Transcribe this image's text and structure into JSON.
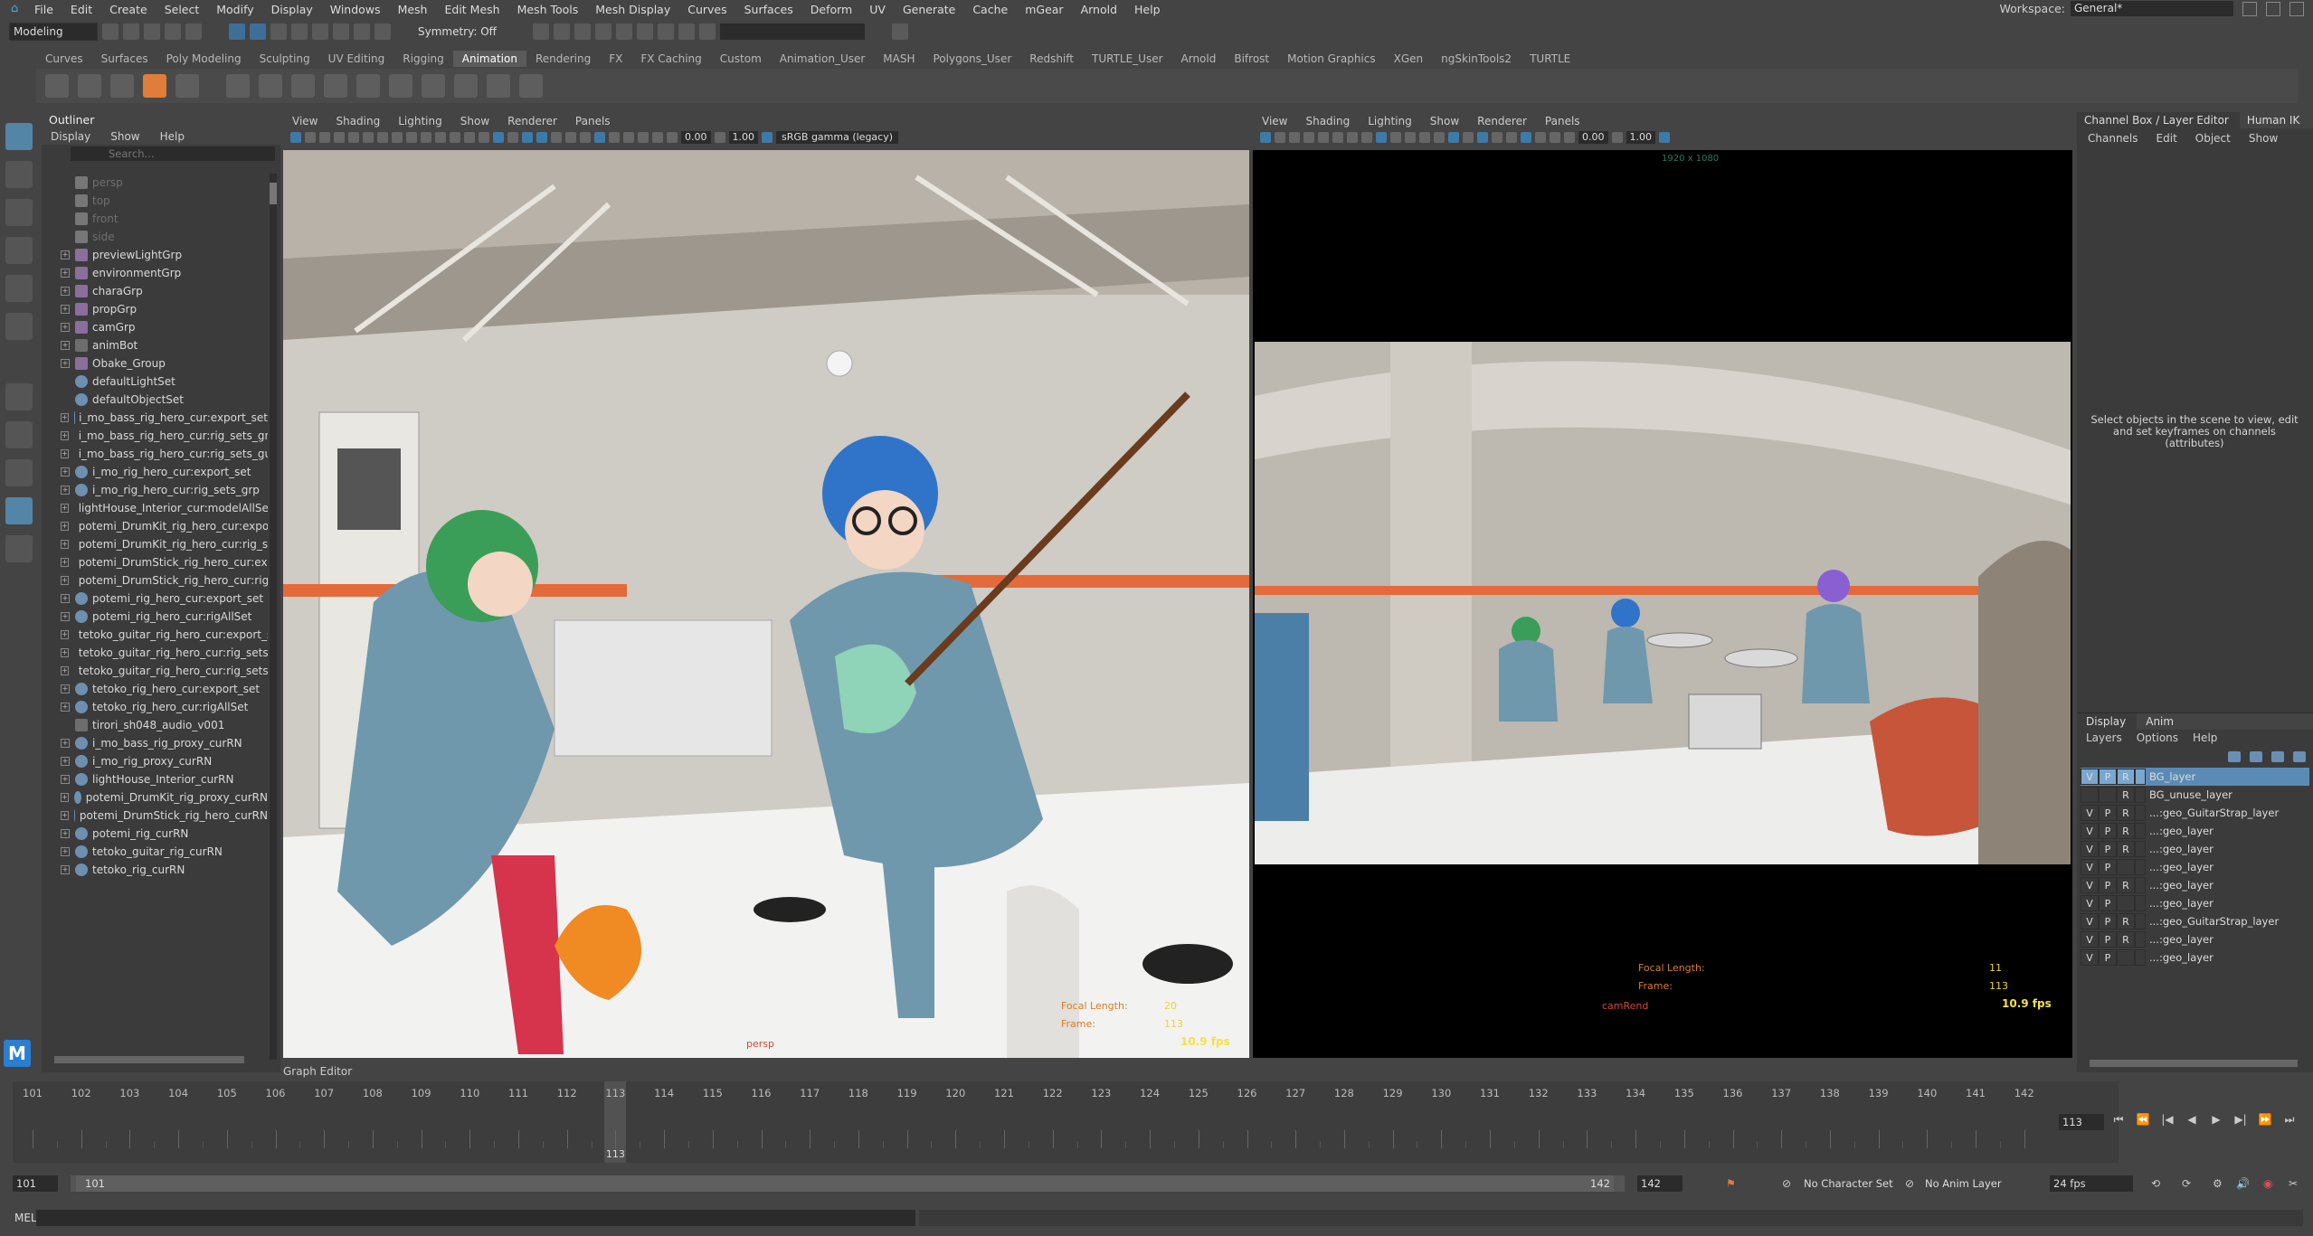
{
  "menubar": {
    "items": [
      "File",
      "Edit",
      "Create",
      "Select",
      "Modify",
      "Display",
      "Windows",
      "Mesh",
      "Edit Mesh",
      "Mesh Tools",
      "Mesh Display",
      "Curves",
      "Surfaces",
      "Deform",
      "UV",
      "Generate",
      "Cache",
      "mGear",
      "Arnold",
      "Help"
    ],
    "workspace_label": "Workspace:",
    "workspace_value": "General*"
  },
  "statusline": {
    "mode": "Modeling",
    "symmetry": "Symmetry: Off"
  },
  "shelf": {
    "tabs": [
      "Curves",
      "Surfaces",
      "Poly Modeling",
      "Sculpting",
      "UV Editing",
      "Rigging",
      "Animation",
      "Rendering",
      "FX",
      "FX Caching",
      "Custom",
      "Animation_User",
      "MASH",
      "Polygons_User",
      "Redshift",
      "TURTLE_User",
      "Arnold",
      "Bifrost",
      "Motion Graphics",
      "XGen",
      "ngSkinTools2",
      "TURTLE"
    ],
    "active": "Animation"
  },
  "outliner": {
    "title": "Outliner",
    "menu": [
      "Display",
      "Show",
      "Help"
    ],
    "search_placeholder": "Search...",
    "items": [
      {
        "label": "persp",
        "icon": "camera-icon",
        "dim": true,
        "exp": false
      },
      {
        "label": "top",
        "icon": "camera-icon",
        "dim": true,
        "exp": false
      },
      {
        "label": "front",
        "icon": "camera-icon",
        "dim": true,
        "exp": false
      },
      {
        "label": "side",
        "icon": "camera-icon",
        "dim": true,
        "exp": false
      },
      {
        "label": "previewLightGrp",
        "icon": "group-icon",
        "exp": true
      },
      {
        "label": "environmentGrp",
        "icon": "group-icon",
        "exp": true
      },
      {
        "label": "charaGrp",
        "icon": "group-icon",
        "exp": true
      },
      {
        "label": "propGrp",
        "icon": "group-icon",
        "exp": true
      },
      {
        "label": "camGrp",
        "icon": "group-icon",
        "exp": true
      },
      {
        "label": "animBot",
        "icon": "node-icon",
        "exp": true
      },
      {
        "label": "Obake_Group",
        "icon": "group-icon",
        "exp": true
      },
      {
        "label": "defaultLightSet",
        "icon": "set-icon",
        "exp": false
      },
      {
        "label": "defaultObjectSet",
        "icon": "set-icon",
        "exp": false
      },
      {
        "label": "i_mo_bass_rig_hero_cur:export_set",
        "icon": "set-icon",
        "exp": true
      },
      {
        "label": "i_mo_bass_rig_hero_cur:rig_sets_grp",
        "icon": "set-icon",
        "exp": true
      },
      {
        "label": "i_mo_bass_rig_hero_cur:rig_sets_guit",
        "icon": "set-icon",
        "exp": true
      },
      {
        "label": "i_mo_rig_hero_cur:export_set",
        "icon": "set-icon",
        "exp": true
      },
      {
        "label": "i_mo_rig_hero_cur:rig_sets_grp",
        "icon": "set-icon",
        "exp": true
      },
      {
        "label": "lightHouse_Interior_cur:modelAllSet",
        "icon": "set-icon",
        "exp": true
      },
      {
        "label": "potemi_DrumKit_rig_hero_cur:export_",
        "icon": "set-icon",
        "exp": true
      },
      {
        "label": "potemi_DrumKit_rig_hero_cur:rig_set:",
        "icon": "set-icon",
        "exp": true
      },
      {
        "label": "potemi_DrumStick_rig_hero_cur:expo",
        "icon": "set-icon",
        "exp": true
      },
      {
        "label": "potemi_DrumStick_rig_hero_cur:rig_s",
        "icon": "set-icon",
        "exp": true
      },
      {
        "label": "potemi_rig_hero_cur:export_set",
        "icon": "set-icon",
        "exp": true
      },
      {
        "label": "potemi_rig_hero_cur:rigAllSet",
        "icon": "set-icon",
        "exp": true
      },
      {
        "label": "tetoko_guitar_rig_hero_cur:export_se",
        "icon": "set-icon",
        "exp": true
      },
      {
        "label": "tetoko_guitar_rig_hero_cur:rig_sets_(",
        "icon": "set-icon",
        "exp": true
      },
      {
        "label": "tetoko_guitar_rig_hero_cur:rig_sets_(",
        "icon": "set-icon",
        "exp": true
      },
      {
        "label": "tetoko_rig_hero_cur:export_set",
        "icon": "set-icon",
        "exp": true
      },
      {
        "label": "tetoko_rig_hero_cur:rigAllSet",
        "icon": "set-icon",
        "exp": true
      },
      {
        "label": "tirori_sh048_audio_v001",
        "icon": "audio-icon",
        "exp": false
      },
      {
        "label": "i_mo_bass_rig_proxy_curRN",
        "icon": "reference-icon",
        "exp": true
      },
      {
        "label": "i_mo_rig_proxy_curRN",
        "icon": "reference-icon",
        "exp": true
      },
      {
        "label": "lightHouse_Interior_curRN",
        "icon": "reference-icon",
        "exp": true
      },
      {
        "label": "potemi_DrumKit_rig_proxy_curRN",
        "icon": "reference-icon",
        "exp": true
      },
      {
        "label": "potemi_DrumStick_rig_hero_curRN",
        "icon": "reference-icon",
        "exp": true
      },
      {
        "label": "potemi_rig_curRN",
        "icon": "reference-icon",
        "exp": true
      },
      {
        "label": "tetoko_guitar_rig_curRN",
        "icon": "reference-icon",
        "exp": true
      },
      {
        "label": "tetoko_rig_curRN",
        "icon": "reference-icon",
        "exp": true
      }
    ]
  },
  "viewport_left": {
    "menu": [
      "View",
      "Shading",
      "Lighting",
      "Show",
      "Renderer",
      "Panels"
    ],
    "near_value": "0.00",
    "far_value": "1.00",
    "colorspace": "sRGB gamma (legacy)",
    "camera_label": "persp",
    "focal_length_label": "Focal Length:",
    "focal_length_value": "20",
    "frame_label": "Frame:",
    "frame_value": "113",
    "fps": "10.9 fps"
  },
  "viewport_right": {
    "menu": [
      "View",
      "Shading",
      "Lighting",
      "Show",
      "Renderer",
      "Panels"
    ],
    "near_value": "0.00",
    "far_value": "1.00",
    "resolution_gate": "1920 x 1080",
    "camera_label": "camRend",
    "focal_length_label": "Focal Length:",
    "focal_length_value": "11",
    "frame_label": "Frame:",
    "frame_value": "113",
    "fps": "10.9 fps"
  },
  "channelbox": {
    "tabs": [
      "Channel Box / Layer Editor",
      "Human IK"
    ],
    "menu": [
      "Channels",
      "Edit",
      "Object",
      "Show"
    ],
    "message": "Select objects in the scene to view, edit and set keyframes on channels (attributes)",
    "layer_tabs": [
      "Display",
      "Anim"
    ],
    "layer_menu": [
      "Layers",
      "Options",
      "Help"
    ],
    "layers": [
      {
        "v": "V",
        "p": "P",
        "r": "R",
        "name": "BG_layer",
        "selected": true
      },
      {
        "v": "",
        "p": "",
        "r": "R",
        "name": "BG_unuse_layer"
      },
      {
        "v": "V",
        "p": "P",
        "r": "R",
        "name": "...:geo_GuitarStrap_layer"
      },
      {
        "v": "V",
        "p": "P",
        "r": "R",
        "name": "...:geo_layer"
      },
      {
        "v": "V",
        "p": "P",
        "r": "R",
        "name": "...:geo_layer"
      },
      {
        "v": "V",
        "p": "P",
        "r": "",
        "name": "...:geo_layer"
      },
      {
        "v": "V",
        "p": "P",
        "r": "R",
        "name": "...:geo_layer"
      },
      {
        "v": "V",
        "p": "P",
        "r": "",
        "name": "...:geo_layer"
      },
      {
        "v": "V",
        "p": "P",
        "r": "R",
        "name": "...:geo_GuitarStrap_layer"
      },
      {
        "v": "V",
        "p": "P",
        "r": "R",
        "name": "...:geo_layer"
      },
      {
        "v": "V",
        "p": "P",
        "r": "",
        "name": "...:geo_layer"
      }
    ]
  },
  "timeline": {
    "graph_editor_label": "Graph Editor",
    "ticks": [
      "101",
      "102",
      "103",
      "104",
      "105",
      "106",
      "107",
      "108",
      "109",
      "110",
      "111",
      "112",
      "113",
      "114",
      "115",
      "116",
      "117",
      "118",
      "119",
      "120",
      "121",
      "122",
      "123",
      "124",
      "125",
      "126",
      "127",
      "128",
      "129",
      "130",
      "131",
      "132",
      "133",
      "134",
      "135",
      "136",
      "137",
      "138",
      "139",
      "140",
      "141",
      "142"
    ],
    "current_frame": "113",
    "current_frame_field": "113"
  },
  "range": {
    "start": "101",
    "inner_start": "101",
    "inner_end": "142",
    "end": "142",
    "character_set": "No Character Set",
    "anim_layer": "No Anim Layer",
    "fps": "24 fps"
  },
  "cmdline": {
    "label": "MEL"
  }
}
